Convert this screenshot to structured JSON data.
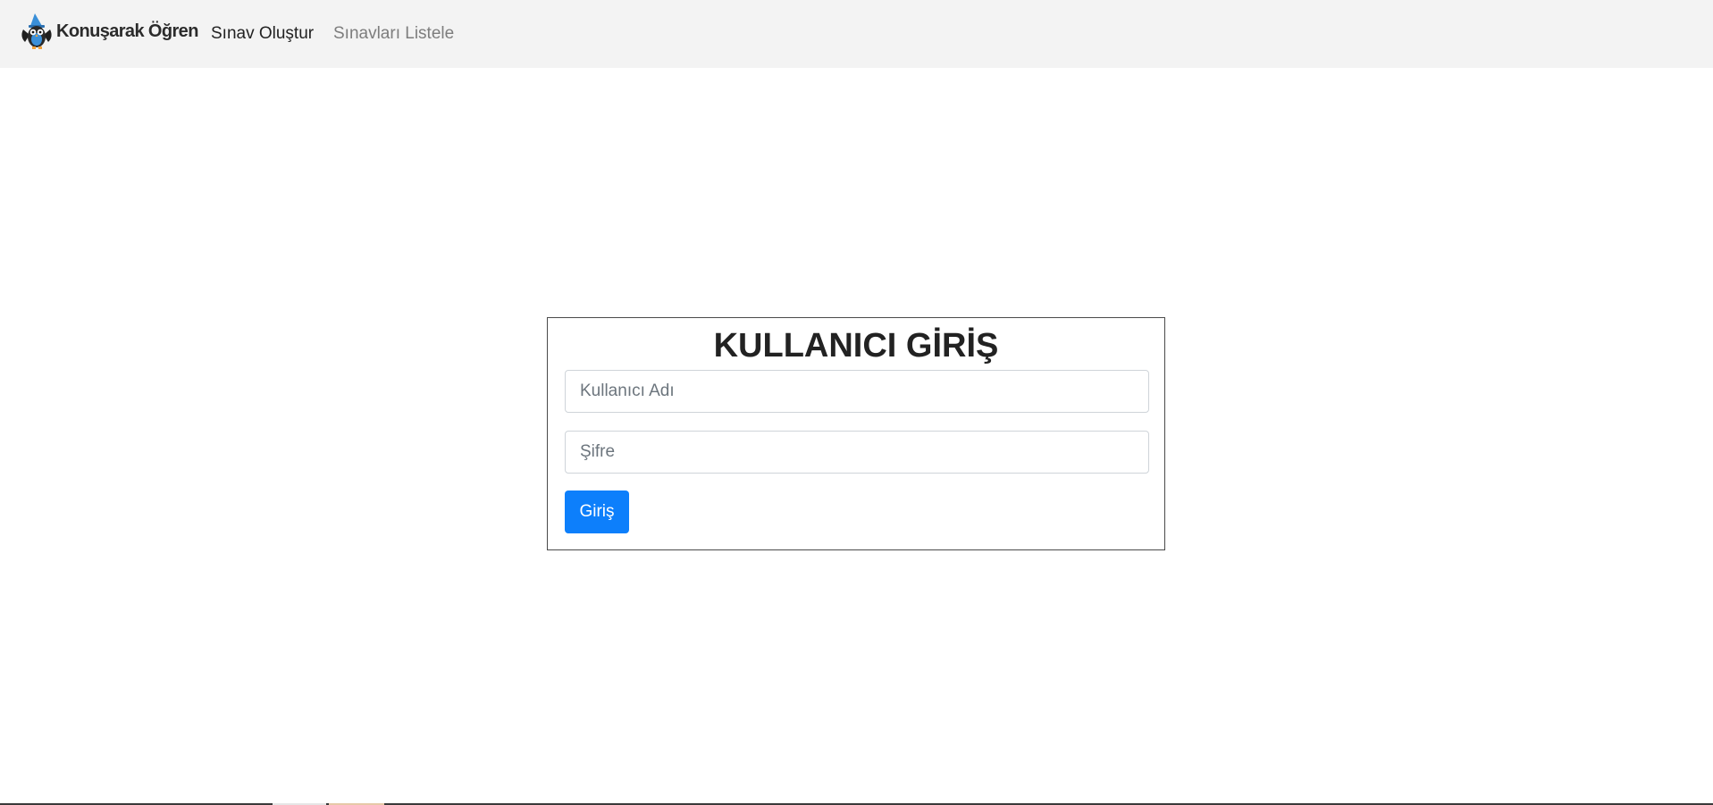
{
  "navbar": {
    "brand_name": "Konuşarak Öğren",
    "logo_icon": "owl-mascot-icon",
    "links": [
      {
        "label": "Sınav Oluştur",
        "state": "active"
      },
      {
        "label": "Sınavları Listele",
        "state": "inactive"
      }
    ]
  },
  "login": {
    "title": "KULLANICI GİRİŞ",
    "username_placeholder": "Kullanıcı Adı",
    "username_value": "",
    "password_placeholder": "Şifre",
    "password_value": "",
    "submit_label": "Giriş"
  },
  "colors": {
    "navbar_bg": "#f3f3f3",
    "primary_button": "#0d7ffb",
    "box_border": "#4a4a4a"
  }
}
